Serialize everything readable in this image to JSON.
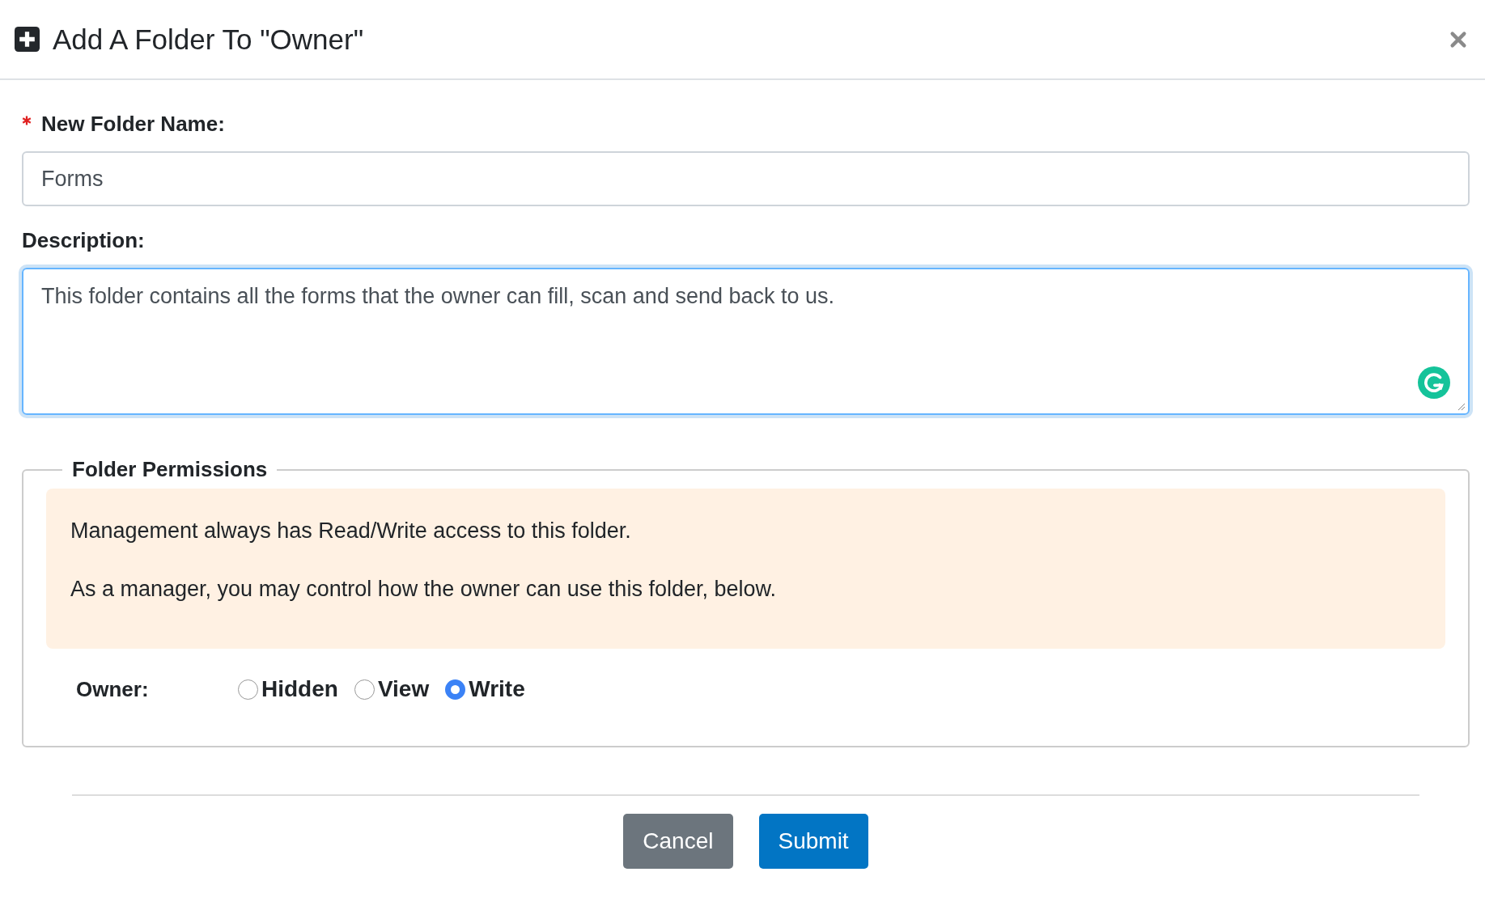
{
  "dialog": {
    "title": "Add A Folder To \"Owner\""
  },
  "name_field": {
    "label": "New Folder Name:",
    "required": true,
    "value": "Forms"
  },
  "description_field": {
    "label": "Description:",
    "value": "This folder contains all the forms that the owner can fill, scan and send back to us. ",
    "focused": true
  },
  "permissions": {
    "legend": "Folder Permissions",
    "notice": [
      "Management always has Read/Write access to this folder.",
      "As a manager, you may control how the owner can use this folder, below."
    ],
    "row_label": "Owner:",
    "options": [
      {
        "label": "Hidden",
        "selected": false
      },
      {
        "label": "View",
        "selected": false
      },
      {
        "label": "Write",
        "selected": true
      }
    ]
  },
  "buttons": [
    {
      "label": "Cancel",
      "kind": "secondary"
    },
    {
      "label": "Submit",
      "kind": "primary"
    }
  ]
}
